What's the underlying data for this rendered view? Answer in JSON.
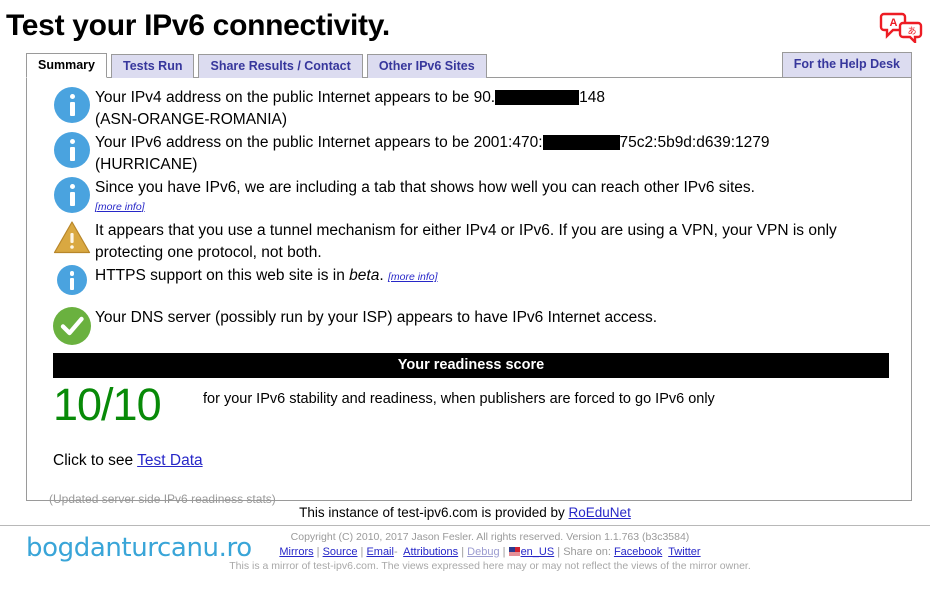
{
  "header": {
    "title": "Test your IPv6 connectivity.",
    "translate_icon": "translate-icon"
  },
  "tabs": [
    {
      "label": "Summary",
      "active": true
    },
    {
      "label": "Tests Run",
      "active": false
    },
    {
      "label": "Share Results / Contact",
      "active": false
    },
    {
      "label": "Other IPv6 Sites",
      "active": false
    }
  ],
  "help_tab": {
    "label": "For the Help Desk"
  },
  "results": [
    {
      "icon": "info-icon",
      "text_before": "Your IPv4 address on the public Internet appears to be 90.",
      "redacted": true,
      "text_after": "148",
      "line2": "(ASN-ORANGE-ROMANIA)"
    },
    {
      "icon": "info-icon",
      "text_before": "Your IPv6 address on the public Internet appears to be 2001:470:",
      "redacted": true,
      "text_after": "75c2:5b9d:d639:1279",
      "line2": "(HURRICANE)"
    },
    {
      "icon": "info-icon",
      "text": "Since you have IPv6, we are including a tab that shows how well you can reach other IPv6 sites.",
      "more_info": "[more info]"
    },
    {
      "icon": "warning-icon",
      "text": "It appears that you use a tunnel mechanism for either IPv4 or IPv6. If you are using a VPN, your VPN is only protecting one protocol, not both."
    },
    {
      "icon": "info-icon",
      "text_before": "HTTPS support on this web site is in ",
      "emphasis": "beta",
      "text_after": ".",
      "more_info": "[more info]"
    },
    {
      "icon": "check-icon",
      "text": "Your DNS server (possibly run by your ISP) appears to have IPv6 Internet access."
    }
  ],
  "score": {
    "bar_label": "Your readiness score",
    "value": "10/10",
    "caption": "for your IPv6 stability and readiness, when publishers are forced to go IPv6 only",
    "color": "#088a08"
  },
  "test_data": {
    "prefix": "Click to see ",
    "link": "Test Data"
  },
  "updated_note": "(Updated server side IPv6 readiness stats)",
  "provided": {
    "text": "This instance of test-ipv6.com is provided by ",
    "link": "RoEduNet"
  },
  "footer": {
    "brand": "bogdanturcanu.ro",
    "copyright": "Copyright (C) 2010, 2017 Jason Fesler. All rights reserved. Version 1.1.763 (b3c3584)",
    "links": {
      "mirrors": "Mirrors",
      "source": "Source",
      "email": "Email",
      "dash": "-",
      "attributions": "Attributions",
      "debug": "Debug",
      "locale": "en_US",
      "share_on": "Share on:",
      "facebook": "Facebook",
      "twitter": "Twitter"
    },
    "mirror_note": "This is a mirror of test-ipv6.com. The views expressed here may or may not reflect the views of the mirror owner."
  },
  "colors": {
    "info": "#4aa3df",
    "warning": "#d9a841",
    "success": "#6ab13f",
    "link": "#2727c8",
    "tab_inactive_bg": "#dcdcf0",
    "tab_text": "#37379c",
    "brand": "#39a5d8"
  }
}
